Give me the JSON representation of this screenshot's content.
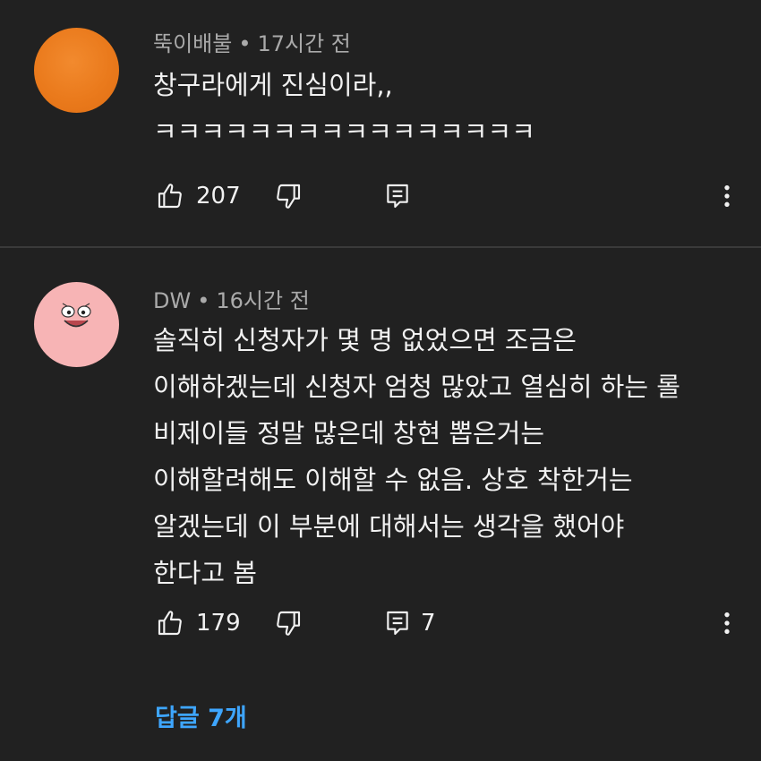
{
  "comments": [
    {
      "author": "뚝이배불",
      "time": "17시간 전",
      "lines": [
        "창구라에게 진심이라,,",
        "ㅋㅋㅋㅋㅋㅋㅋㅋㅋㅋㅋㅋㅋㅋㅋㅋ"
      ],
      "likes": "207",
      "replies": "",
      "avatar_color": "#ea7a1c"
    },
    {
      "author": "DW",
      "time": "16시간 전",
      "lines": [
        "솔직히 신청자가 몇 명 없었으면 조금은",
        "이해하겠는데 신청자 엄청 많았고 열심히 하는 롤",
        "비제이들 정말 많은데 창현 뽑은거는",
        "이해할려해도 이해할 수 없음. 상호 착한거는",
        "알겠는데 이 부분에 대해서는 생각을 했어야",
        "한다고 봄"
      ],
      "likes": "179",
      "replies": "7",
      "avatar_color": "#f7b4b5",
      "replies_link": "답글 7개"
    }
  ],
  "separator": "•",
  "colors": {
    "background": "#212121",
    "text": "#f1f1f1",
    "meta": "#aaaaaa",
    "link": "#3ea6ff"
  },
  "icons": [
    "thumbs-up-icon",
    "thumbs-down-icon",
    "reply-icon",
    "more-vert-icon"
  ]
}
